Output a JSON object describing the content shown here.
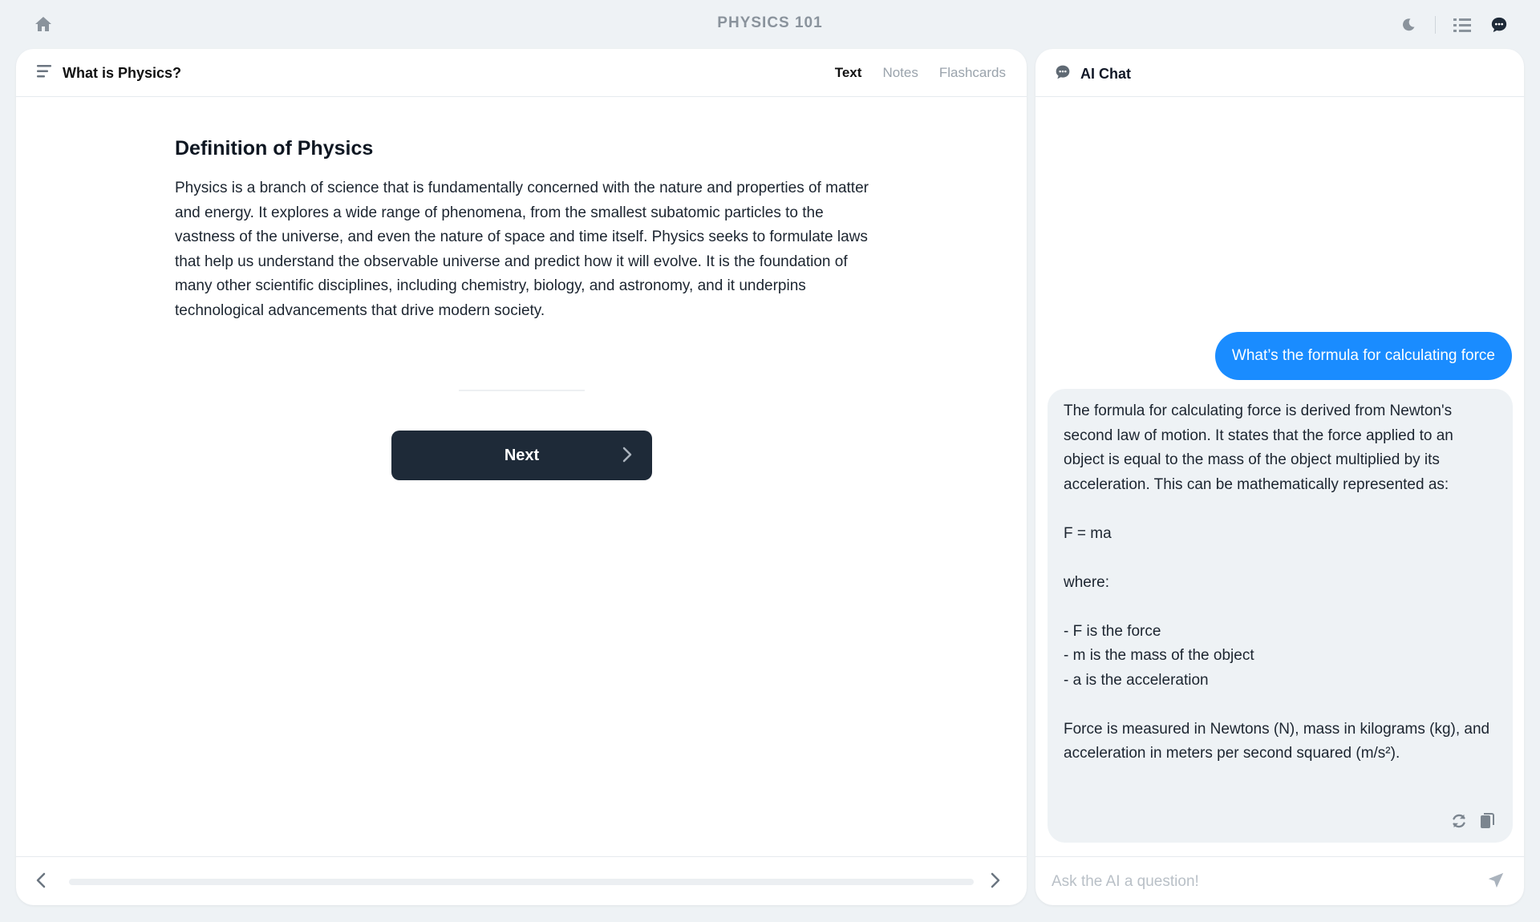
{
  "app": {
    "title": "PHYSICS 101"
  },
  "topbar": {
    "icons": [
      "home-icon",
      "moon-icon",
      "list-icon",
      "chat-bubble-icon"
    ]
  },
  "lesson": {
    "title": "What is Physics?",
    "tabs": [
      {
        "label": "Text",
        "active": true
      },
      {
        "label": "Notes",
        "active": false
      },
      {
        "label": "Flashcards",
        "active": false
      }
    ],
    "heading": "Definition of Physics",
    "body": "Physics is a branch of science that is fundamentally concerned with the nature and properties of matter and energy. It explores a wide range of phenomena, from the smallest subatomic particles to the vastness of the universe, and even the nature of space and time itself. Physics seeks to formulate laws that help us understand the observable universe and predict how it will evolve. It is the foundation of many other scientific disciplines, including chemistry, biology, and astronomy, and it underpins technological advancements that drive modern society.",
    "next_label": "Next",
    "progress": 0
  },
  "chat": {
    "title": "AI Chat",
    "messages": [
      {
        "role": "user",
        "text": "What’s the formula for calculating force"
      },
      {
        "role": "ai",
        "text": "The formula for calculating force is derived from Newton's second law of motion. It states that the force applied to an object is equal to the mass of the object multiplied by its acceleration. This can be mathematically represented as:\n\nF = ma\n\nwhere:\n\n- F is the force\n- m is the mass of the object\n- a is the acceleration\n\nForce is measured in Newtons (N), mass in kilograms (kg), and acceleration in meters per second squared (m/s²)."
      }
    ],
    "input_placeholder": "Ask the AI a question!",
    "input_value": ""
  },
  "colors": {
    "accent": "#1a8cff",
    "button_dark": "#1e2a38",
    "background": "#eef2f5"
  }
}
